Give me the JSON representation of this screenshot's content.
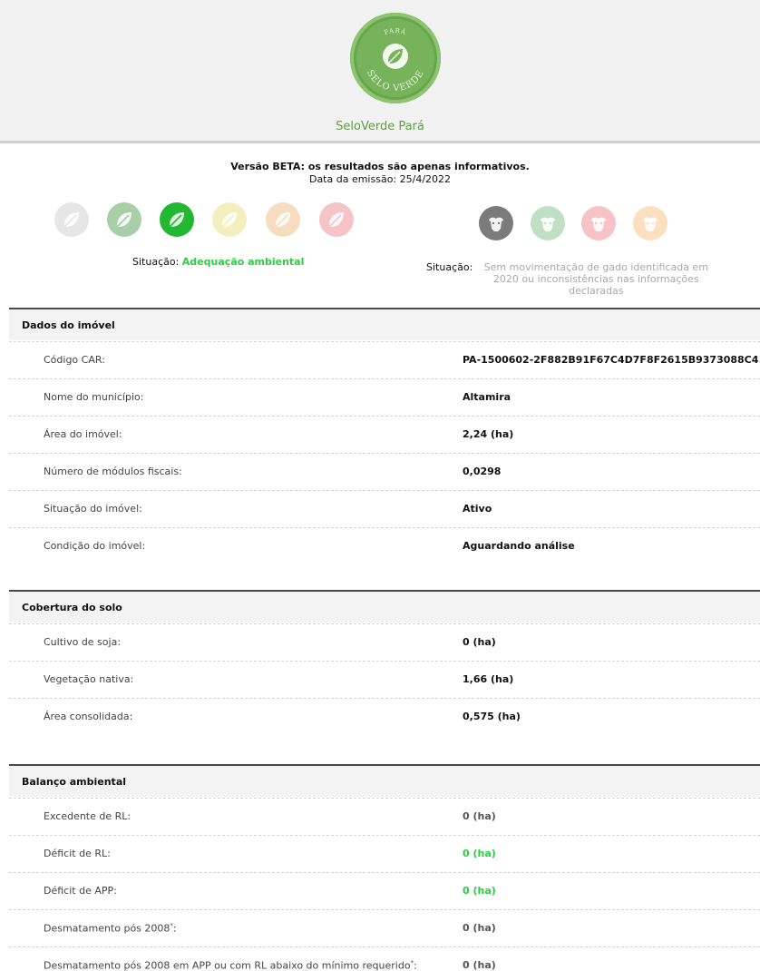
{
  "header": {
    "logo_text_top": "PARÁ",
    "logo_text_bottom": "SELO VERDE",
    "title": "SeloVerde Pará"
  },
  "notice": {
    "beta": "Versão BETA: os resultados são apenas informativos.",
    "emission": "Data da emissão: 25/4/2022"
  },
  "environmental_status": {
    "label": "Situação:",
    "value": "Adequação ambiental",
    "icons": [
      {
        "name": "leaf-icon",
        "color": "#e6e6e6"
      },
      {
        "name": "leaf-icon",
        "color": "#a9cfa8"
      },
      {
        "name": "leaf-icon",
        "color": "#22b832"
      },
      {
        "name": "leaf-icon",
        "color": "#f3efbf"
      },
      {
        "name": "leaf-icon",
        "color": "#f7ddbf"
      },
      {
        "name": "leaf-icon",
        "color": "#f5c4c8"
      }
    ]
  },
  "cattle_status": {
    "label": "Situação:",
    "value": "Sem movimentação de gado identificada em 2020 ou inconsistências nas informações declaradas",
    "icons": [
      {
        "name": "cattle-icon",
        "color": "#7b7b7b"
      },
      {
        "name": "cattle-icon",
        "color": "#bfe0c4"
      },
      {
        "name": "cattle-icon",
        "color": "#f8c3c7"
      },
      {
        "name": "cattle-icon",
        "color": "#fbe0c0"
      }
    ]
  },
  "sections": {
    "property": {
      "title": "Dados do imóvel",
      "rows": [
        {
          "label": "Código CAR:",
          "value": "PA-1500602-2F882B91F67C4D7F8F2615B9373088C4"
        },
        {
          "label": "Nome do município:",
          "value": "Altamira"
        },
        {
          "label": "Área do imóvel:",
          "value": "2,24 (ha)"
        },
        {
          "label": "Número de módulos fiscais:",
          "value": "0,0298"
        },
        {
          "label": "Situação do imóvel:",
          "value": "Ativo"
        },
        {
          "label": "Condição do imóvel:",
          "value": "Aguardando análise"
        }
      ]
    },
    "soil": {
      "title": "Cobertura do solo",
      "rows": [
        {
          "label": "Cultivo de soja:",
          "value": "0 (ha)"
        },
        {
          "label": "Vegetação nativa:",
          "value": "1,66 (ha)"
        },
        {
          "label": "Área consolidada:",
          "value": "0,575 (ha)"
        }
      ]
    },
    "balance": {
      "title": "Balanço ambiental",
      "rows": [
        {
          "label": "Excedente de RL:",
          "value": "0 (ha)"
        },
        {
          "label": "Déficit de RL:",
          "value": "0 (ha)"
        },
        {
          "label": "Déficit de APP:",
          "value": "0 (ha)"
        },
        {
          "label": "Desmatamento pós 2008",
          "note": "*",
          "suffix": ":",
          "value": "0 (ha)"
        },
        {
          "label": "Desmatamento pós 2008 em APP ou com RL abaixo do mínimo requerido",
          "note": "*",
          "suffix": ":",
          "value": "0 (ha)"
        }
      ]
    }
  }
}
